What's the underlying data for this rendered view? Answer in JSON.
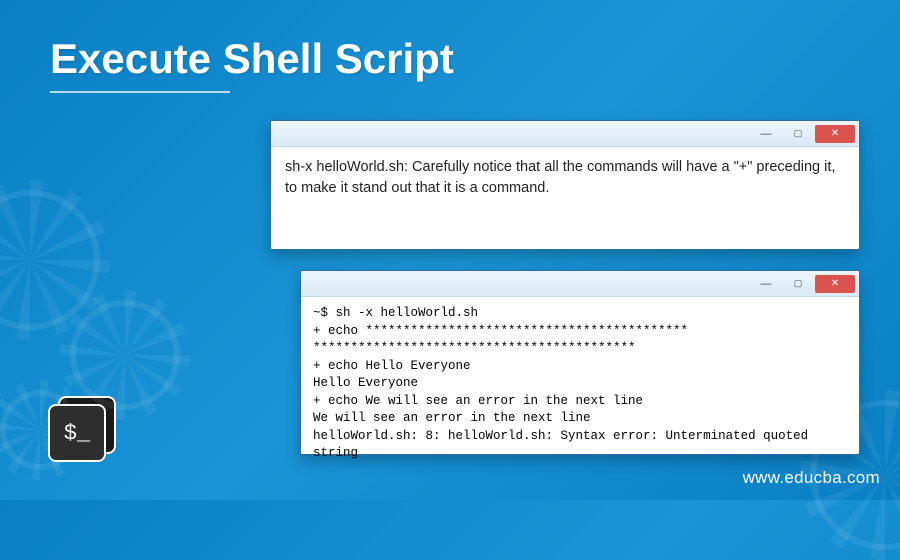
{
  "page": {
    "title": "Execute Shell Script",
    "watermark": "www.educba.com"
  },
  "window1": {
    "text": "sh-x helloWorld.sh: Carefully notice that all the commands will have a \"+\" preceding it, to make it stand out that it is a command."
  },
  "window2": {
    "lines": [
      "~$ sh -x helloWorld.sh",
      "+ echo *******************************************",
      "*******************************************",
      "+ echo Hello Everyone",
      "Hello Everyone",
      "+ echo We will see an error in the next line",
      "We will see an error in the next line",
      "helloWorld.sh: 8: helloWorld.sh: Syntax error: Unterminated quoted string"
    ]
  },
  "shell_icon": {
    "prompt": "$_"
  }
}
